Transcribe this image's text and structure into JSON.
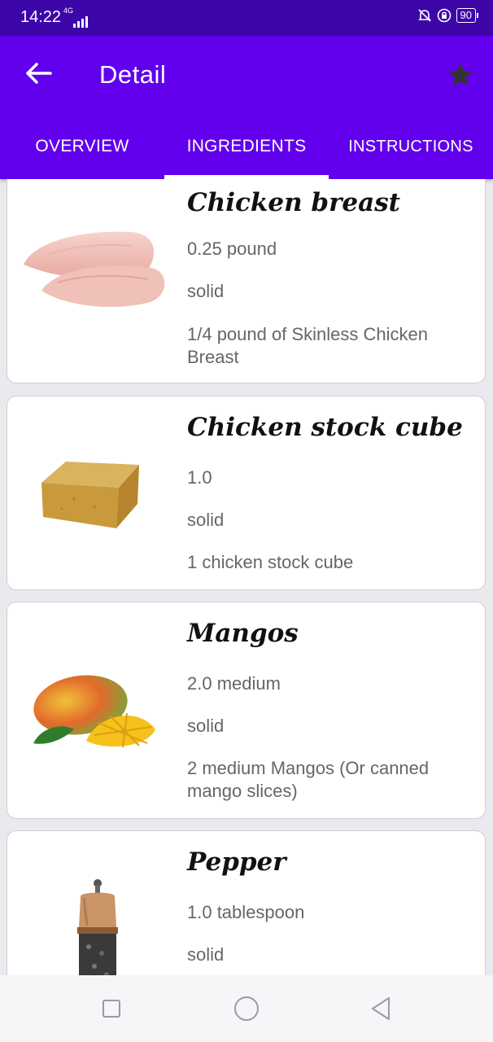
{
  "status_bar": {
    "time": "14:22",
    "network": "4G",
    "battery": "90"
  },
  "app_bar": {
    "title": "Detail"
  },
  "tabs": [
    {
      "label": "OVERVIEW",
      "selected": false
    },
    {
      "label": "INGREDIENTS",
      "selected": true
    },
    {
      "label": "INSTRUCTIONS",
      "selected": false
    }
  ],
  "ingredients": [
    {
      "name": "Chicken breast",
      "quantity": "0.25  pound",
      "state": "solid",
      "description": "1/4 pound of Skinless Chicken Breast",
      "image": "chicken-breast-image"
    },
    {
      "name": "Chicken stock cube",
      "quantity": "1.0",
      "state": "solid",
      "description": "1 chicken stock cube",
      "image": "stock-cube-image"
    },
    {
      "name": "Mangos",
      "quantity": "2.0  medium",
      "state": "solid",
      "description": "2 medium Mangos (Or canned mango slices)",
      "image": "mango-image"
    },
    {
      "name": "Pepper",
      "quantity": "1.0  tablespoon",
      "state": "solid",
      "description": "",
      "image": "pepper-grinder-image"
    }
  ],
  "colors": {
    "primary": "#6200ee",
    "primary_dark": "#3d06a9",
    "background": "#e9e9ee"
  }
}
